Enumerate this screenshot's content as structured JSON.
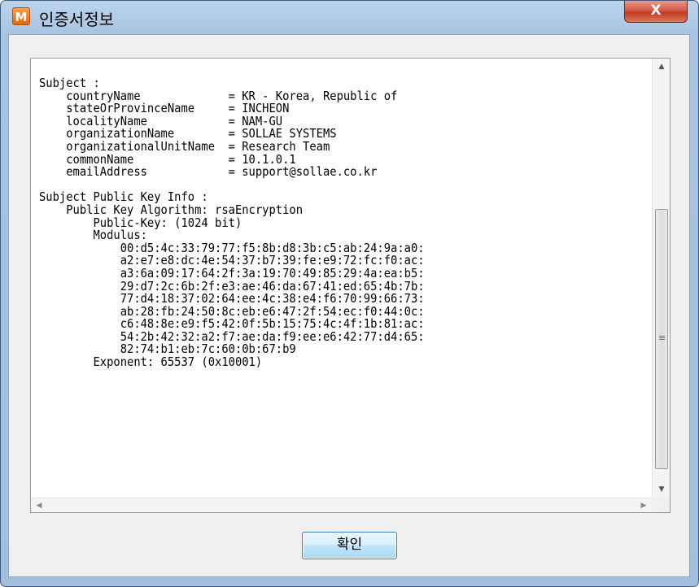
{
  "window": {
    "title": "인증서정보",
    "app_icon_letter": "M",
    "close_label": "X"
  },
  "certificate_text": "Subject :\n    countryName             = KR - Korea, Republic of\n    stateOrProvinceName     = INCHEON\n    localityName            = NAM-GU\n    organizationName        = SOLLAE SYSTEMS\n    organizationalUnitName  = Research Team\n    commonName              = 10.1.0.1\n    emailAddress            = support@sollae.co.kr\n\nSubject Public Key Info :\n    Public Key Algorithm: rsaEncryption\n        Public-Key: (1024 bit)\n        Modulus:\n            00:d5:4c:33:79:77:f5:8b:d8:3b:c5:ab:24:9a:a0:\n            a2:e7:e8:dc:4e:54:37:b7:39:fe:e9:72:fc:f0:ac:\n            a3:6a:09:17:64:2f:3a:19:70:49:85:29:4a:ea:b5:\n            29:d7:2c:6b:2f:e3:ae:46:da:67:41:ed:65:4b:7b:\n            77:d4:18:37:02:64:ee:4c:38:e4:f6:70:99:66:73:\n            ab:28:fb:24:50:8c:eb:e6:47:2f:54:ec:f0:44:0c:\n            c6:48:8e:e9:f5:42:0f:5b:15:75:4c:4f:1b:81:ac:\n            54:2b:42:32:a2:f7:ae:da:f9:ee:e6:42:77:d4:65:\n            82:74:b1:eb:7c:60:0b:67:b9\n        Exponent: 65537 (0x10001)",
  "scrollbar": {
    "up_arrow": "▲",
    "down_arrow": "▼",
    "left_arrow": "◀",
    "right_arrow": "▶",
    "grip": "≡"
  },
  "buttons": {
    "ok_label": "확인"
  }
}
